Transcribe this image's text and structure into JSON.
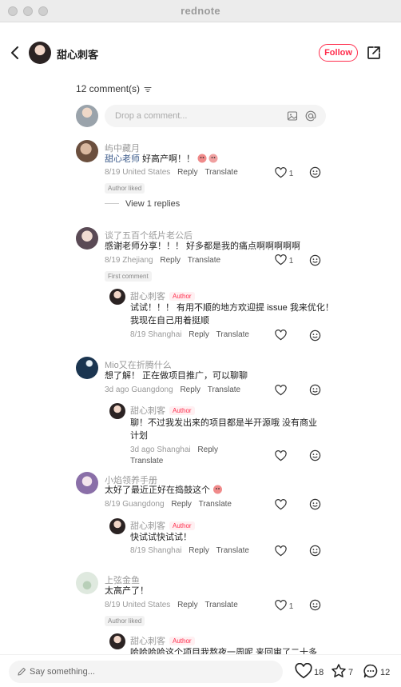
{
  "app": {
    "title": "rednote"
  },
  "header": {
    "author_name": "甜心刺客",
    "follow_label": "Follow"
  },
  "comments_count_label": "12 comment(s)",
  "comment_input": {
    "placeholder": "Drop a comment..."
  },
  "comments": [
    {
      "user": "屿中藏月",
      "mention": "甜心老师",
      "text": " 好高产啊！！",
      "date": "8/19",
      "location": "United States",
      "reply": "Reply",
      "translate": "Translate",
      "likes": "1",
      "badge": "Author liked",
      "view_replies": "View 1 replies"
    },
    {
      "user": "谈了五百个纸片老公后",
      "text": "感谢老师分享！！！ 好多都是我的痛点啊啊啊啊啊",
      "date": "8/19",
      "location": "Zhejiang",
      "reply": "Reply",
      "translate": "Translate",
      "likes": "1",
      "badge": "First comment",
      "sub": {
        "user": "甜心刺客",
        "author_tag": "Author",
        "text_line1": "试试！！！ 有用不顺的地方欢迎提 issue 我来优化！",
        "text_line2": "我现在自己用着挺顺",
        "date": "8/19",
        "location": "Shanghai",
        "reply": "Reply",
        "translate": "Translate"
      }
    },
    {
      "user": "Mio又在折腾什么",
      "text": "想了解！ 正在做项目推广，可以聊聊",
      "date": "3d ago",
      "location": "Guangdong",
      "reply": "Reply",
      "translate": "Translate",
      "sub": {
        "user": "甜心刺客",
        "author_tag": "Author",
        "text_line1": "聊！不过我发出来的项目都是半开源哦 没有商业",
        "text_line2": "计划",
        "date": "3d ago",
        "location": "Shanghai",
        "reply": "Reply",
        "translate": "Translate"
      }
    },
    {
      "user": "小焰领养手册",
      "text": "太好了最近正好在捣鼓这个",
      "date": "8/19",
      "location": "Guangdong",
      "reply": "Reply",
      "translate": "Translate",
      "sub": {
        "user": "甜心刺客",
        "author_tag": "Author",
        "text_line1": "快试试快试试！",
        "date": "8/19",
        "location": "Shanghai",
        "reply": "Reply",
        "translate": "Translate"
      }
    },
    {
      "user": "上弦金鱼",
      "text": "太高产了！",
      "date": "8/19",
      "location": "United States",
      "reply": "Reply",
      "translate": "Translate",
      "likes": "1",
      "badge": "Author liked",
      "sub": {
        "user": "甜心刺客",
        "author_tag": "Author",
        "text_line1": "哈哈哈哈这个项目我熬夜一周呢 来回审了二十多"
      }
    }
  ],
  "bottom": {
    "say_placeholder": "Say something...",
    "likes": "18",
    "stars": "7",
    "comments": "12"
  },
  "colors": {
    "accent": "#ff2e4d",
    "muted": "#999999"
  },
  "icons": [
    "back-icon",
    "share-icon",
    "sort-icon",
    "image-icon",
    "at-icon",
    "heart-icon",
    "smiley-icon",
    "pencil-icon",
    "star-icon",
    "chat-icon"
  ]
}
